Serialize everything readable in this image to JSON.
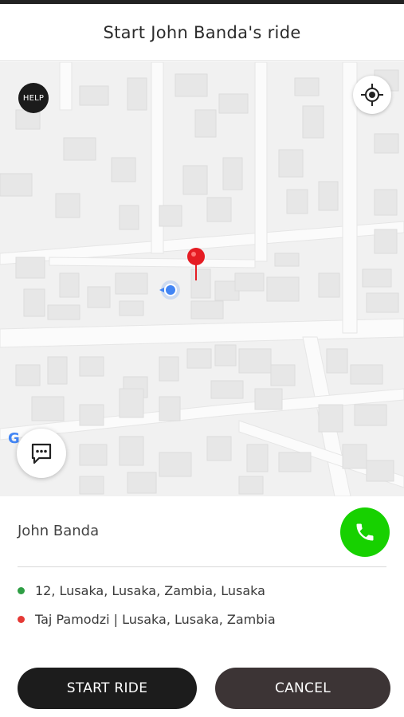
{
  "header": {
    "title": "Start John Banda's ride"
  },
  "map": {
    "help_label": "HELP",
    "locate_icon": "crosshair-icon",
    "chat_icon": "chat-bubble-icon",
    "google_logo": "G",
    "destination_pin_color": "#e51c23",
    "current_location_color": "#4285f4"
  },
  "driver": {
    "name": "John Banda",
    "call_icon": "phone-icon",
    "call_color": "#17d100"
  },
  "route": {
    "pickup": {
      "address": "12, Lusaka, Lusaka, Zambia, Lusaka",
      "dot_color": "#2e9e44"
    },
    "dropoff": {
      "address": "Taj Pamodzi | Lusaka, Lusaka, Zambia",
      "dot_color": "#e53935"
    }
  },
  "actions": {
    "start_label": "START RIDE",
    "cancel_label": "CANCEL"
  }
}
